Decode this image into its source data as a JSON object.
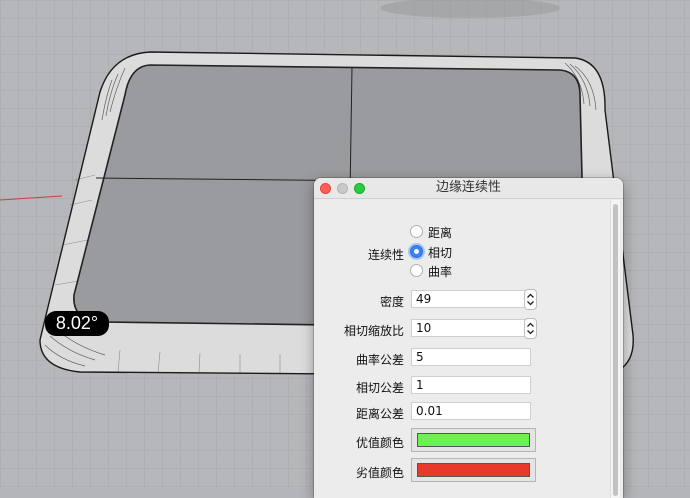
{
  "viewport": {
    "angle_readout": "8.02°"
  },
  "dialog": {
    "title": "边缘连续性",
    "continuity": {
      "label": "连续性",
      "options": [
        "距离",
        "相切",
        "曲率"
      ],
      "selected": "相切"
    },
    "fields": {
      "density": {
        "label": "密度",
        "value": "49"
      },
      "tangent_scale": {
        "label": "相切缩放比",
        "value": "10"
      },
      "curvature_tolerance": {
        "label": "曲率公差",
        "value": "5"
      },
      "tangent_tolerance": {
        "label": "相切公差",
        "value": "1"
      },
      "distance_tolerance": {
        "label": "距离公差",
        "value": "0.01"
      }
    },
    "colors": {
      "good": {
        "label": "优值颜色",
        "color": "#6df052"
      },
      "bad": {
        "label": "劣值颜色",
        "color": "#e63a2a"
      }
    }
  }
}
